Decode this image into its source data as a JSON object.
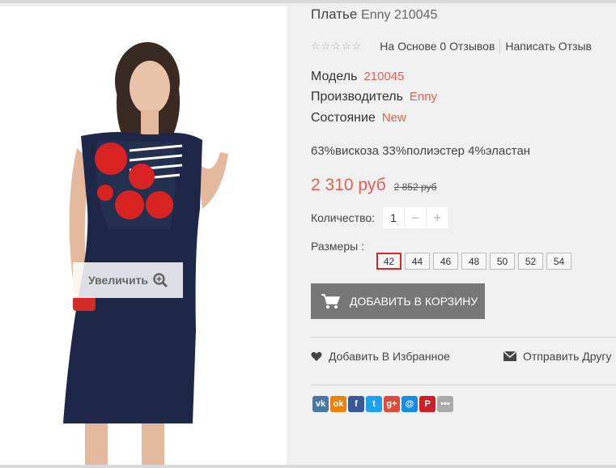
{
  "product": {
    "title": "Платье",
    "brand_code": "Enny 210045",
    "rating_text": "☆☆☆☆☆",
    "reviews_link": "На Основе 0 Отзывов",
    "write_review": "Написать Отзыв",
    "model_label": "Модель",
    "model_value": "210045",
    "maker_label": "Производитель",
    "maker_value": "Enny",
    "state_label": "Состояние",
    "state_value": "New",
    "description": "63%вискоза 33%полиэстер 4%эластан",
    "price_new": "2 310 руб",
    "price_old": "2 852 руб",
    "qty_label": "Количество:",
    "qty_value": "1",
    "sizes_label": "Размеры :",
    "sizes": [
      "42",
      "44",
      "46",
      "48",
      "50",
      "52",
      "54"
    ],
    "selected_size": "42",
    "cart_button": "ДОБАВИТЬ В КОРЗИНУ",
    "wishlist": "Добавить В Избранное",
    "share_friend": "Отправить Другу"
  },
  "image": {
    "zoom_label": "Увеличить"
  },
  "colors": {
    "accent": "#e06052",
    "selected_size_border": "#d42a2a",
    "cart_bg": "#777777"
  },
  "social": [
    {
      "name": "vk-icon",
      "label": "vk",
      "color": "#4a76a8"
    },
    {
      "name": "ok-icon",
      "label": "ok",
      "color": "#ee8208"
    },
    {
      "name": "facebook-icon",
      "label": "f",
      "color": "#3b5998"
    },
    {
      "name": "twitter-icon",
      "label": "t",
      "color": "#1da1f2"
    },
    {
      "name": "googleplus-icon",
      "label": "g+",
      "color": "#dd4b39"
    },
    {
      "name": "mail-icon",
      "label": "@",
      "color": "#168de2"
    },
    {
      "name": "pinterest-icon",
      "label": "P",
      "color": "#cb2027"
    },
    {
      "name": "more-icon",
      "label": "•••",
      "color": "#aaaaaa"
    }
  ]
}
